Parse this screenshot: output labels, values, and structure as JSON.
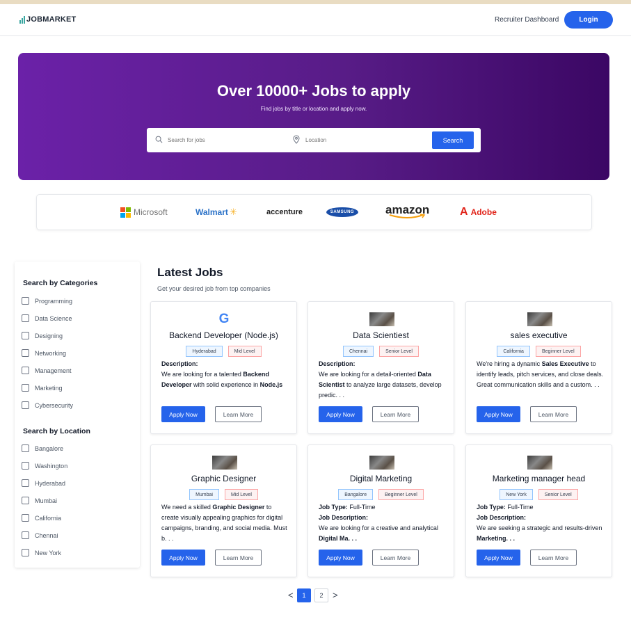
{
  "topbar": {
    "logo_job": "JOB",
    "logo_market": "MARKET",
    "recruiter_link": "Recruiter Dashboard",
    "login_label": "Login"
  },
  "hero": {
    "title": "Over 10000+ Jobs to apply",
    "subtitle": "Find jobs by title or location and apply now.",
    "search_placeholder": "Search for jobs",
    "location_placeholder": "Location",
    "search_button": "Search"
  },
  "brands": {
    "microsoft": "Microsoft",
    "walmart": "Walmart",
    "accenture": "accenture",
    "samsung": "SAMSUNG",
    "amazon": "amazon",
    "adobe": "Adobe"
  },
  "sidebar": {
    "categories_heading": "Search by Categories",
    "categories": [
      "Programming",
      "Data Science",
      "Designing",
      "Networking",
      "Management",
      "Marketing",
      "Cybersecurity"
    ],
    "location_heading": "Search by Location",
    "locations": [
      "Bangalore",
      "Washington",
      "Hyderabad",
      "Mumbai",
      "California",
      "Chennai",
      "New York"
    ]
  },
  "main": {
    "title": "Latest Jobs",
    "subtitle": "Get your desired job from top companies",
    "apply_label": "Apply Now",
    "learn_label": "Learn More"
  },
  "jobs": [
    {
      "title": "Backend Developer (Node.js)",
      "location": "Hyderabad",
      "level": "Mid Level",
      "desc_heading": "Description:",
      "desc_pre": "We are looking for a talented ",
      "desc_bold": "Backend Developer",
      "desc_mid": " with solid experience in ",
      "desc_bold2": "Node.js",
      "desc_post": ""
    },
    {
      "title": "Data Scientiest",
      "location": "Chennai",
      "level": "Senior Level",
      "desc_heading": "Description:",
      "desc_pre": "We are looking for a detail-oriented ",
      "desc_bold": "Data Scientist",
      "desc_mid": " to analyze large datasets, develop predic. . .",
      "desc_bold2": "",
      "desc_post": ""
    },
    {
      "title": "sales executive",
      "location": "California",
      "level": "Beginner Level",
      "desc_heading": "",
      "desc_pre": "We're hiring a dynamic ",
      "desc_bold": "Sales Executive",
      "desc_mid": " to identify leads, pitch services, and close deals. Great communication skills and a custom. . .",
      "desc_bold2": "",
      "desc_post": ""
    },
    {
      "title": "Graphic Designer",
      "location": "Mumbai",
      "level": "Mid Level",
      "desc_heading": "",
      "desc_pre": "We need a skilled ",
      "desc_bold": "Graphic Designer",
      "desc_mid": " to create visually appealing graphics for digital campaigns, branding, and social media. Must b. . .",
      "desc_bold2": "",
      "desc_post": ""
    },
    {
      "title": "Digital Marketing",
      "location": "Bangalore",
      "level": "Beginner Level",
      "jobtype_label": "Job Type:",
      "jobtype_value": " Full-Time",
      "desc_heading": "Job Description:",
      "desc_pre": "We are looking for a creative and analytical ",
      "desc_bold": "Digital Ma. . .",
      "desc_mid": "",
      "desc_bold2": "",
      "desc_post": ""
    },
    {
      "title": "Marketing manager head",
      "location": "New York",
      "level": "Senior Level",
      "jobtype_label": "Job Type:",
      "jobtype_value": " Full-Time",
      "desc_heading": "Job Description:",
      "desc_pre": "We are seeking a strategic and results-driven ",
      "desc_bold": "Marketing. . .",
      "desc_mid": "",
      "desc_bold2": "",
      "desc_post": ""
    }
  ],
  "pagination": {
    "prev": "<",
    "next": ">",
    "pages": [
      "1",
      "2"
    ],
    "current": "1"
  }
}
